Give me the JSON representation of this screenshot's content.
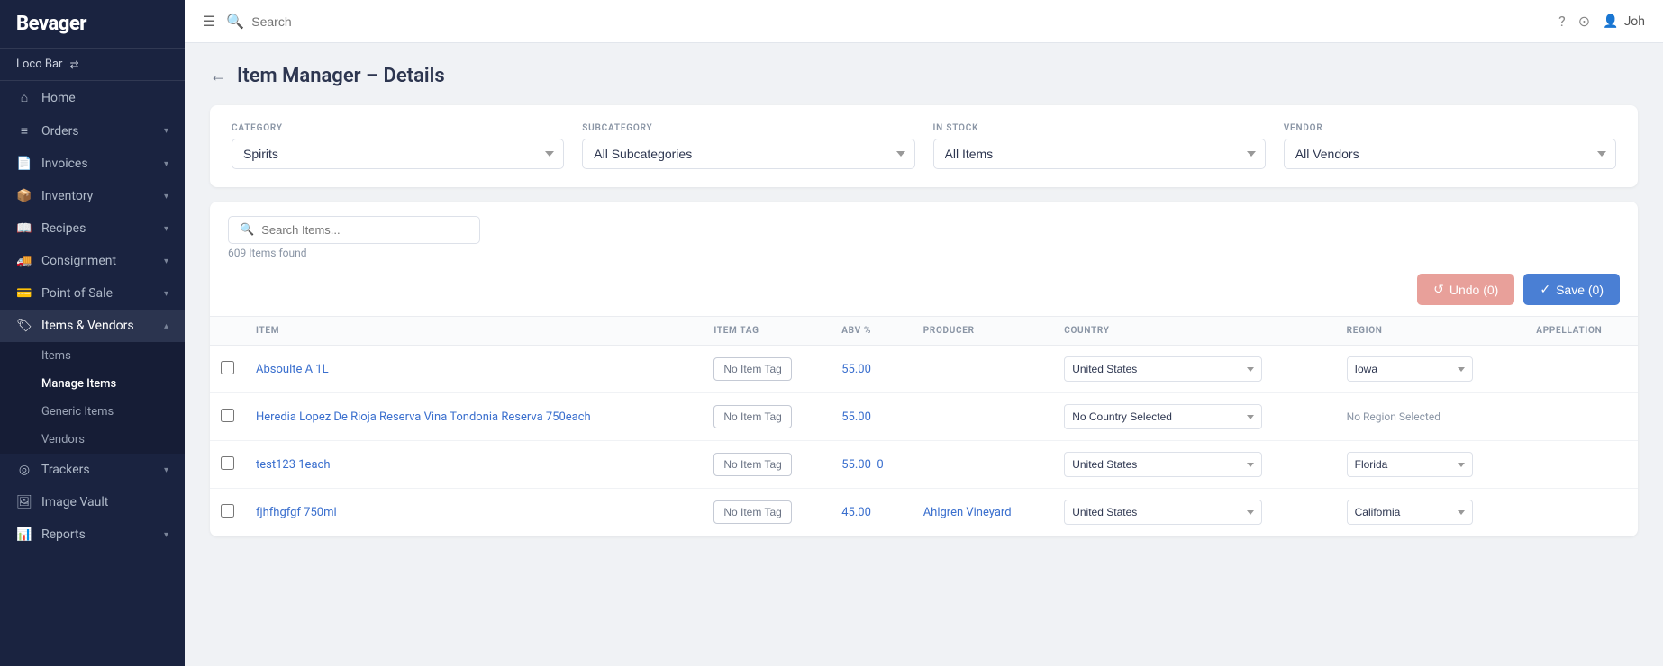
{
  "app": {
    "name": "Bevager",
    "logo_text": "Bevager"
  },
  "venue": {
    "name": "Loco Bar",
    "switch_icon": "⇄"
  },
  "topbar": {
    "search_placeholder": "Search",
    "icons": [
      "?",
      "☉",
      "👤"
    ],
    "user": "Joh"
  },
  "sidebar": {
    "items": [
      {
        "label": "Home",
        "icon": "⌂",
        "has_children": false
      },
      {
        "label": "Orders",
        "icon": "📋",
        "has_children": true
      },
      {
        "label": "Invoices",
        "icon": "🧾",
        "has_children": true
      },
      {
        "label": "Inventory",
        "icon": "📦",
        "has_children": true
      },
      {
        "label": "Recipes",
        "icon": "📖",
        "has_children": true
      },
      {
        "label": "Consignment",
        "icon": "🚚",
        "has_children": true
      },
      {
        "label": "Point of Sale",
        "icon": "💳",
        "has_children": true
      },
      {
        "label": "Items & Vendors",
        "icon": "🏷",
        "has_children": true,
        "active": true
      }
    ],
    "sub_items": [
      {
        "label": "Items",
        "active": false
      },
      {
        "label": "Manage Items",
        "active": true
      },
      {
        "label": "Generic Items",
        "active": false
      },
      {
        "label": "Vendors",
        "active": false
      }
    ],
    "bottom_items": [
      {
        "label": "Trackers",
        "icon": "📡",
        "has_children": true
      },
      {
        "label": "Image Vault",
        "icon": "🖼",
        "has_children": false
      },
      {
        "label": "Reports",
        "icon": "📊",
        "has_children": true
      }
    ]
  },
  "page": {
    "title": "Item Manager – Details",
    "back_label": "←"
  },
  "filters": {
    "category_label": "CATEGORY",
    "category_value": "Spirits",
    "subcategory_label": "SUBCATEGORY",
    "subcategory_value": "All Subcategories",
    "instock_label": "IN STOCK",
    "instock_value": "All Items",
    "vendor_label": "VENDOR",
    "vendor_value": "All Vendors"
  },
  "toolbar": {
    "search_placeholder": "Search Items...",
    "items_found": "609 Items found",
    "undo_label": "Undo (0)",
    "save_label": "Save (0)"
  },
  "table": {
    "columns": [
      "",
      "ITEM",
      "ITEM TAG",
      "ABV %",
      "PRODUCER",
      "COUNTRY",
      "REGION",
      "APPELLATION"
    ],
    "rows": [
      {
        "id": 1,
        "item": "Absoulte A 1L",
        "item_tag": "No Item Tag",
        "abv": "55.00",
        "producer": "",
        "country": "United States",
        "region": "Iowa",
        "appellation": ""
      },
      {
        "id": 2,
        "item": "Heredia Lopez De Rioja Reserva Vina Tondonia Reserva 750each",
        "item_tag": "No Item Tag",
        "abv": "55.00",
        "producer": "",
        "country": "No Country Selected",
        "region": "No Region Selected",
        "appellation": ""
      },
      {
        "id": 3,
        "item": "test123 1each",
        "item_tag": "No Item Tag",
        "abv": "55.00",
        "abv_extra": "0",
        "producer": "",
        "country": "United States",
        "region": "Florida",
        "appellation": ""
      },
      {
        "id": 4,
        "item": "fjhfhgfgf 750ml",
        "item_tag": "No Item Tag",
        "abv": "45.00",
        "producer": "Ahlgren Vineyard",
        "country": "United States",
        "region": "California",
        "appellation": ""
      }
    ]
  }
}
